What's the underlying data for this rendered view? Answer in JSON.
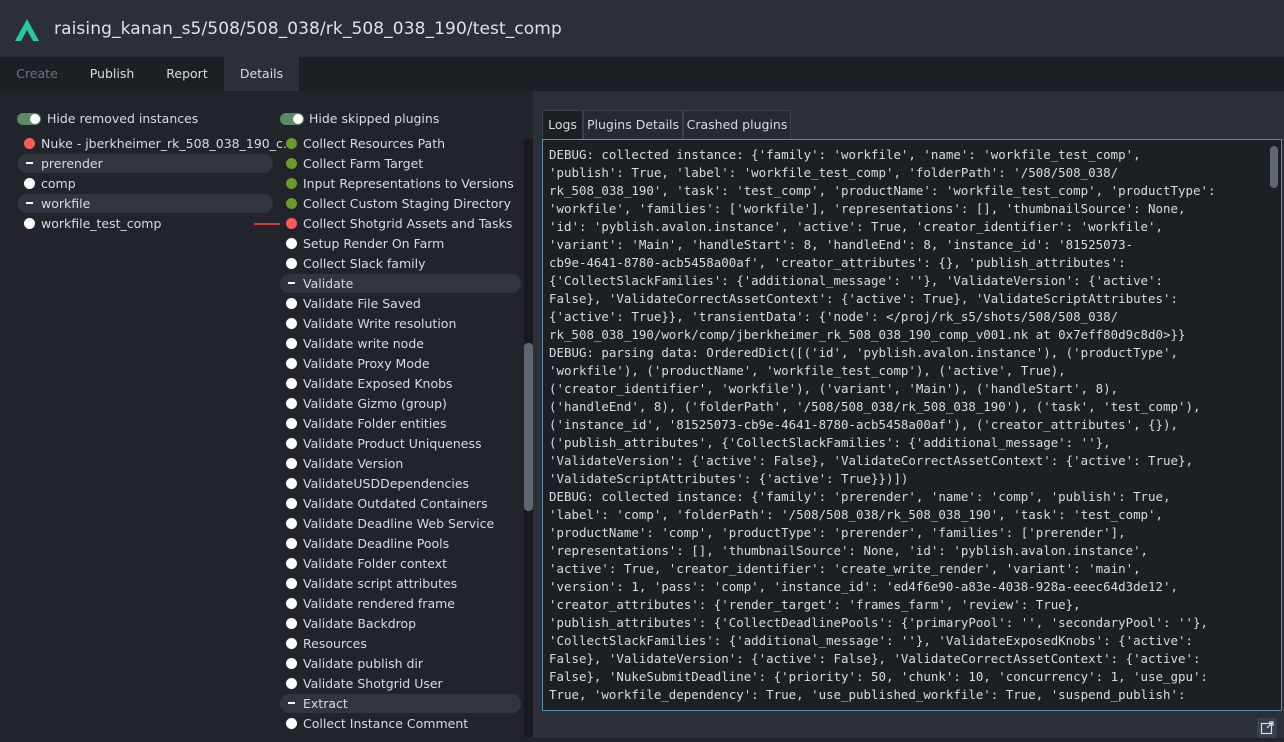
{
  "header": {
    "title": "raising_kanan_s5/508/508_038/rk_508_038_190/test_comp",
    "logo_icon": "ayon-logo-icon"
  },
  "tabs": [
    {
      "label": "Create",
      "state": "disabled"
    },
    {
      "label": "Publish",
      "state": "normal"
    },
    {
      "label": "Report",
      "state": "normal"
    },
    {
      "label": "Details",
      "state": "active"
    }
  ],
  "toggles": {
    "hide_removed": "Hide removed instances",
    "hide_skipped": "Hide skipped plugins"
  },
  "instances": [
    {
      "label": "Nuke - jberkheimer_rk_508_038_190_c...",
      "status": "red"
    },
    {
      "label": "prerender",
      "status": "group"
    },
    {
      "label": "comp",
      "status": "white"
    },
    {
      "label": "workfile",
      "status": "group"
    },
    {
      "label": "workfile_test_comp",
      "status": "white"
    }
  ],
  "plugins": [
    {
      "label": "Collect Resources Path",
      "status": "green"
    },
    {
      "label": "Collect Farm Target",
      "status": "green"
    },
    {
      "label": "Input Representations to Versions",
      "status": "green"
    },
    {
      "label": "Collect Custom Staging Directory",
      "status": "green"
    },
    {
      "label": "Collect Shotgrid Assets and Tasks",
      "status": "red"
    },
    {
      "label": "Setup Render On Farm",
      "status": "white"
    },
    {
      "label": "Collect Slack family",
      "status": "white"
    },
    {
      "label": "Validate",
      "status": "group"
    },
    {
      "label": "Validate File Saved",
      "status": "white"
    },
    {
      "label": "Validate Write resolution",
      "status": "white"
    },
    {
      "label": "Validate write node",
      "status": "white"
    },
    {
      "label": "Validate Proxy Mode",
      "status": "white"
    },
    {
      "label": "Validate Exposed Knobs",
      "status": "white"
    },
    {
      "label": "Validate Gizmo (group)",
      "status": "white"
    },
    {
      "label": "Validate Folder entities",
      "status": "white"
    },
    {
      "label": "Validate Product Uniqueness",
      "status": "white"
    },
    {
      "label": "Validate Version",
      "status": "white"
    },
    {
      "label": "ValidateUSDDependencies",
      "status": "white"
    },
    {
      "label": "Validate Outdated Containers",
      "status": "white"
    },
    {
      "label": "Validate Deadline Web Service",
      "status": "white"
    },
    {
      "label": "Validate Deadline Pools",
      "status": "white"
    },
    {
      "label": "Validate Folder context",
      "status": "white"
    },
    {
      "label": "Validate script attributes",
      "status": "white"
    },
    {
      "label": "Validate rendered frame",
      "status": "white"
    },
    {
      "label": "Validate Backdrop",
      "status": "white"
    },
    {
      "label": "Resources",
      "status": "white"
    },
    {
      "label": "Validate publish dir",
      "status": "white"
    },
    {
      "label": "Validate Shotgrid User",
      "status": "white"
    },
    {
      "label": "Extract",
      "status": "group"
    },
    {
      "label": "Collect Instance Comment",
      "status": "white"
    }
  ],
  "detail_tabs": [
    {
      "label": "Logs",
      "active": true
    },
    {
      "label": "Plugins Details",
      "active": false
    },
    {
      "label": "Crashed plugins",
      "active": false
    }
  ],
  "logs": "DEBUG: collected instance: {'family': 'workfile', 'name': 'workfile_test_comp',\n'publish': True, 'label': 'workfile_test_comp', 'folderPath': '/508/508_038/\nrk_508_038_190', 'task': 'test_comp', 'productName': 'workfile_test_comp', 'productType':\n'workfile', 'families': ['workfile'], 'representations': [], 'thumbnailSource': None,\n'id': 'pyblish.avalon.instance', 'active': True, 'creator_identifier': 'workfile',\n'variant': 'Main', 'handleStart': 8, 'handleEnd': 8, 'instance_id': '81525073-\ncb9e-4641-8780-acb5458a00af', 'creator_attributes': {}, 'publish_attributes':\n{'CollectSlackFamilies': {'additional_message': ''}, 'ValidateVersion': {'active':\nFalse}, 'ValidateCorrectAssetContext': {'active': True}, 'ValidateScriptAttributes':\n{'active': True}}, 'transientData': {'node': </proj/rk_s5/shots/508/508_038/\nrk_508_038_190/work/comp/jberkheimer_rk_508_038_190_comp_v001.nk at 0x7eff80d9c8d0>}}\nDEBUG: parsing data: OrderedDict([('id', 'pyblish.avalon.instance'), ('productType',\n'workfile'), ('productName', 'workfile_test_comp'), ('active', True),\n('creator_identifier', 'workfile'), ('variant', 'Main'), ('handleStart', 8),\n('handleEnd', 8), ('folderPath', '/508/508_038/rk_508_038_190'), ('task', 'test_comp'),\n('instance_id', '81525073-cb9e-4641-8780-acb5458a00af'), ('creator_attributes', {}),\n('publish_attributes', {'CollectSlackFamilies': {'additional_message': ''},\n'ValidateVersion': {'active': False}, 'ValidateCorrectAssetContext': {'active': True},\n'ValidateScriptAttributes': {'active': True}})])\nDEBUG: collected instance: {'family': 'prerender', 'name': 'comp', 'publish': True,\n'label': 'comp', 'folderPath': '/508/508_038/rk_508_038_190', 'task': 'test_comp',\n'productName': 'comp', 'productType': 'prerender', 'families': ['prerender'],\n'representations': [], 'thumbnailSource': None, 'id': 'pyblish.avalon.instance',\n'active': True, 'creator_identifier': 'create_write_render', 'variant': 'main',\n'version': 1, 'pass': 'comp', 'instance_id': 'ed4f6e90-a83e-4038-928a-eeec64d3de12',\n'creator_attributes': {'render_target': 'frames_farm', 'review': True},\n'publish_attributes': {'CollectDeadlinePools': {'primaryPool': '', 'secondaryPool': ''},\n'CollectSlackFamilies': {'additional_message': ''}, 'ValidateExposedKnobs': {'active':\nFalse}, 'ValidateVersion': {'active': False}, 'ValidateCorrectAssetContext': {'active':\nFalse}, 'NukeSubmitDeadline': {'priority': 50, 'chunk': 10, 'concurrency': 1, 'use_gpu':\nTrue, 'workfile_dependency': True, 'use_published_workfile': True, 'suspend_publish':",
  "icons": {
    "expand": "expand-icon"
  }
}
